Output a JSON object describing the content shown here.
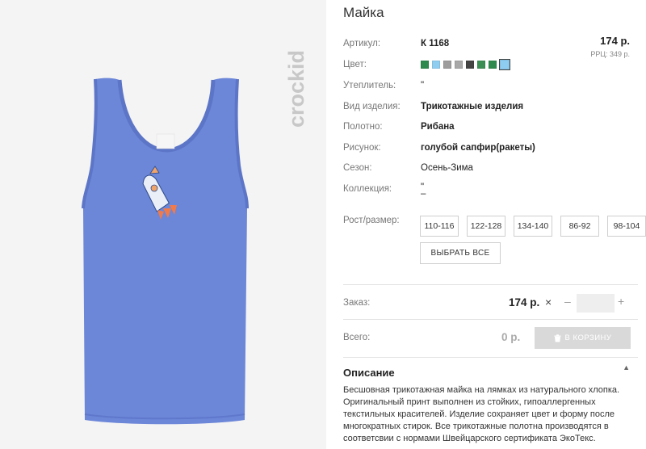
{
  "brand": {
    "name": "crockid"
  },
  "product": {
    "title": "Майка",
    "price": "174 р.",
    "rrp": "РРЦ: 349 р."
  },
  "attributes": {
    "article_label": "Артикул:",
    "article_value": "К 1168",
    "color_label": "Цвет:",
    "insulation_label": "Утеплитель:",
    "insulation_value": "\"",
    "type_label": "Вид изделия:",
    "type_value": "Трикотажные изделия",
    "fabric_label": "Полотно:",
    "fabric_value": "Рибана",
    "pattern_label": "Рисунок:",
    "pattern_value": "голубой сапфир(ракеты)",
    "season_label": "Сезон:",
    "season_value": "Осень-Зима",
    "collection_label": "Коллекция:",
    "collection_value_1": "\"",
    "collection_value_2": "–"
  },
  "colors": [
    "#2f8a4f",
    "#8ecdf0",
    "#9d9d9d",
    "#a8a8a8",
    "#444444",
    "#3b8f55",
    "#2f8a4f",
    "#8ecdf0"
  ],
  "selected_color_index": 7,
  "sizes": {
    "label": "Рост/размер:",
    "options": [
      "110-116",
      "122-128",
      "134-140",
      "86-92",
      "98-104"
    ],
    "select_all": "ВЫБРАТЬ ВСЕ"
  },
  "order": {
    "label": "Заказ:",
    "price": "174 р.",
    "times": "×",
    "minus": "–",
    "plus": "+",
    "quantity": ""
  },
  "total": {
    "label": "Всего:",
    "value": "0 р.",
    "cart_button": "В КОРЗИНУ"
  },
  "description": {
    "title": "Описание",
    "toggle": "▲",
    "text": "Бесшовная трикотажная майка на лямках из натурального хлопка. Оригинальный принт выполнен из стойких, гипоаллергенных текстильных красителей. Изделие сохраняет цвет и форму после многократных стирок. Все трикотажные полотна производятся в соответсвии с нормами Швейцарского сертификата ЭкоТекс."
  }
}
